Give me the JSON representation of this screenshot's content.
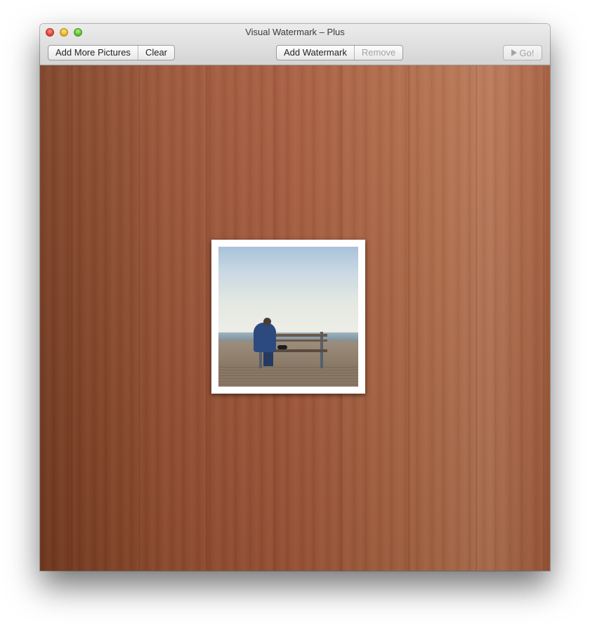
{
  "window": {
    "title": "Visual Watermark – Plus"
  },
  "toolbar": {
    "add_more_pictures_label": "Add More Pictures",
    "clear_label": "Clear",
    "add_watermark_label": "Add Watermark",
    "remove_label": "Remove",
    "go_label": "Go!"
  },
  "canvas": {
    "background": "wood-texture",
    "photo_count": 1
  },
  "icons": {
    "close": "close-icon",
    "minimize": "minimize-icon",
    "zoom": "zoom-icon",
    "go": "play-icon"
  },
  "colors": {
    "close": "#e0443a",
    "minimize": "#e9b128",
    "zoom": "#5fbf30",
    "wood": "#a6593a"
  }
}
